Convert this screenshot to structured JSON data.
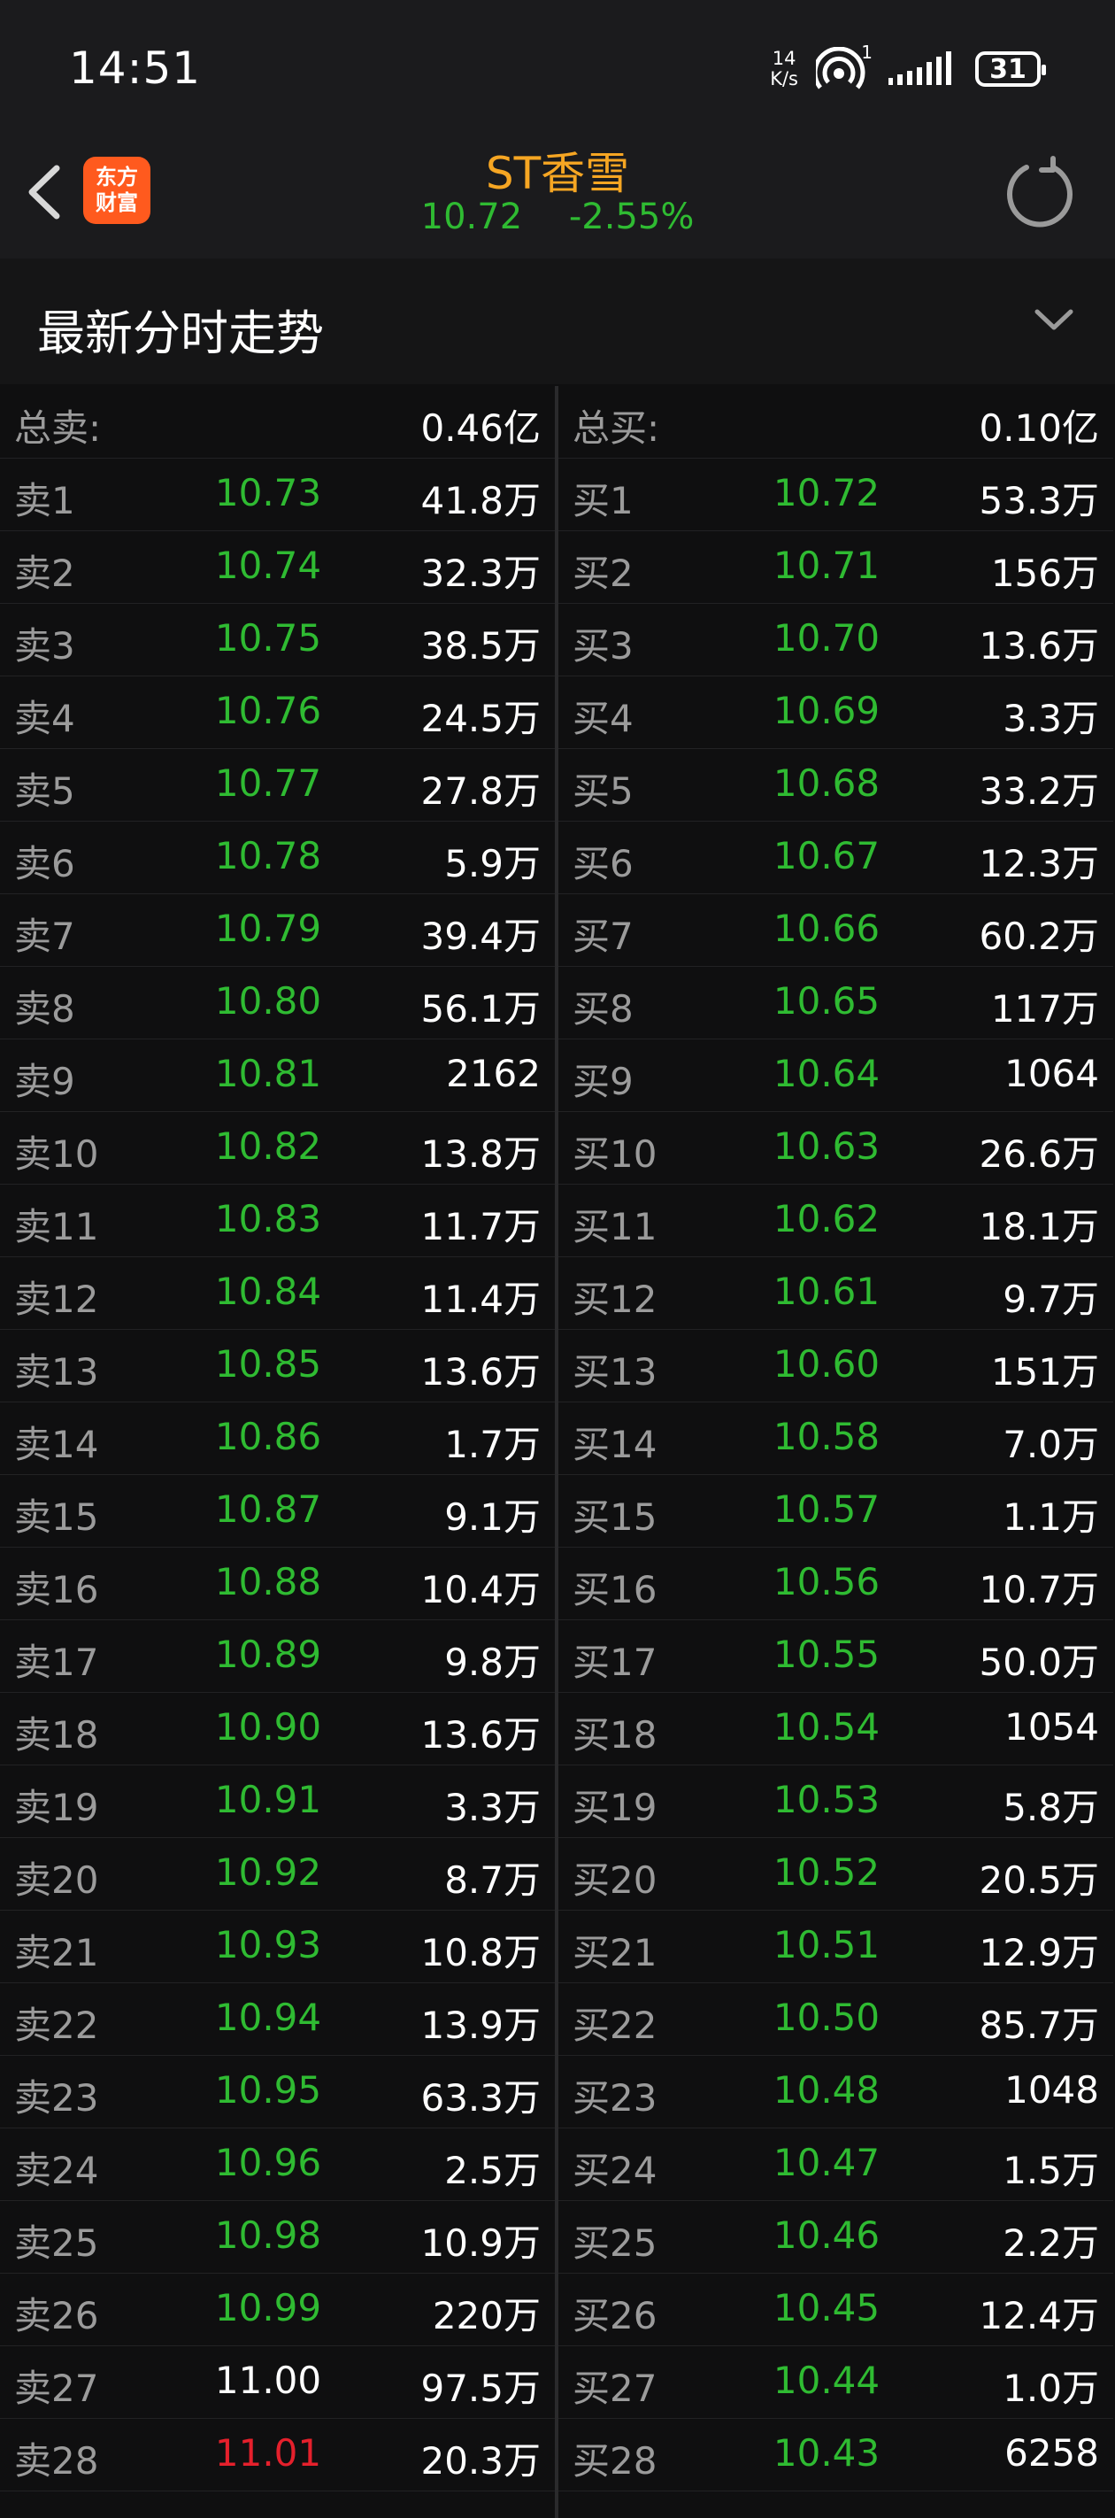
{
  "status_bar": {
    "time": "14:51",
    "net_speed_value": "14",
    "net_speed_unit": "K/s",
    "hotspot_badge": "1",
    "battery": "31"
  },
  "header": {
    "logo_line1": "东方",
    "logo_line2": "财富",
    "stock_name": "ST香雪",
    "price": "10.72",
    "change_pct": "-2.55%"
  },
  "section": {
    "title": "最新分时走势"
  },
  "colors": {
    "up_red": "#e5202c",
    "down_green": "#2fbb32",
    "flat_white": "#ffffff",
    "name_orange": "#f6a623",
    "logo_orange": "#ff5a1e"
  },
  "sell_side": {
    "total_label": "总卖:",
    "total_value": "0.46亿",
    "levels": [
      {
        "label": "卖1",
        "price": "10.73",
        "volume": "41.8万",
        "dir": "down"
      },
      {
        "label": "卖2",
        "price": "10.74",
        "volume": "32.3万",
        "dir": "down"
      },
      {
        "label": "卖3",
        "price": "10.75",
        "volume": "38.5万",
        "dir": "down"
      },
      {
        "label": "卖4",
        "price": "10.76",
        "volume": "24.5万",
        "dir": "down"
      },
      {
        "label": "卖5",
        "price": "10.77",
        "volume": "27.8万",
        "dir": "down"
      },
      {
        "label": "卖6",
        "price": "10.78",
        "volume": "5.9万",
        "dir": "down"
      },
      {
        "label": "卖7",
        "price": "10.79",
        "volume": "39.4万",
        "dir": "down"
      },
      {
        "label": "卖8",
        "price": "10.80",
        "volume": "56.1万",
        "dir": "down"
      },
      {
        "label": "卖9",
        "price": "10.81",
        "volume": "2162",
        "dir": "down"
      },
      {
        "label": "卖10",
        "price": "10.82",
        "volume": "13.8万",
        "dir": "down"
      },
      {
        "label": "卖11",
        "price": "10.83",
        "volume": "11.7万",
        "dir": "down"
      },
      {
        "label": "卖12",
        "price": "10.84",
        "volume": "11.4万",
        "dir": "down"
      },
      {
        "label": "卖13",
        "price": "10.85",
        "volume": "13.6万",
        "dir": "down"
      },
      {
        "label": "卖14",
        "price": "10.86",
        "volume": "1.7万",
        "dir": "down"
      },
      {
        "label": "卖15",
        "price": "10.87",
        "volume": "9.1万",
        "dir": "down"
      },
      {
        "label": "卖16",
        "price": "10.88",
        "volume": "10.4万",
        "dir": "down"
      },
      {
        "label": "卖17",
        "price": "10.89",
        "volume": "9.8万",
        "dir": "down"
      },
      {
        "label": "卖18",
        "price": "10.90",
        "volume": "13.6万",
        "dir": "down"
      },
      {
        "label": "卖19",
        "price": "10.91",
        "volume": "3.3万",
        "dir": "down"
      },
      {
        "label": "卖20",
        "price": "10.92",
        "volume": "8.7万",
        "dir": "down"
      },
      {
        "label": "卖21",
        "price": "10.93",
        "volume": "10.8万",
        "dir": "down"
      },
      {
        "label": "卖22",
        "price": "10.94",
        "volume": "13.9万",
        "dir": "down"
      },
      {
        "label": "卖23",
        "price": "10.95",
        "volume": "63.3万",
        "dir": "down"
      },
      {
        "label": "卖24",
        "price": "10.96",
        "volume": "2.5万",
        "dir": "down"
      },
      {
        "label": "卖25",
        "price": "10.98",
        "volume": "10.9万",
        "dir": "down"
      },
      {
        "label": "卖26",
        "price": "10.99",
        "volume": "220万",
        "dir": "down"
      },
      {
        "label": "卖27",
        "price": "11.00",
        "volume": "97.5万",
        "dir": "flat"
      },
      {
        "label": "卖28",
        "price": "11.01",
        "volume": "20.3万",
        "dir": "up"
      }
    ]
  },
  "buy_side": {
    "total_label": "总买:",
    "total_value": "0.10亿",
    "levels": [
      {
        "label": "买1",
        "price": "10.72",
        "volume": "53.3万",
        "dir": "down"
      },
      {
        "label": "买2",
        "price": "10.71",
        "volume": "156万",
        "dir": "down"
      },
      {
        "label": "买3",
        "price": "10.70",
        "volume": "13.6万",
        "dir": "down"
      },
      {
        "label": "买4",
        "price": "10.69",
        "volume": "3.3万",
        "dir": "down"
      },
      {
        "label": "买5",
        "price": "10.68",
        "volume": "33.2万",
        "dir": "down"
      },
      {
        "label": "买6",
        "price": "10.67",
        "volume": "12.3万",
        "dir": "down"
      },
      {
        "label": "买7",
        "price": "10.66",
        "volume": "60.2万",
        "dir": "down"
      },
      {
        "label": "买8",
        "price": "10.65",
        "volume": "117万",
        "dir": "down"
      },
      {
        "label": "买9",
        "price": "10.64",
        "volume": "1064",
        "dir": "down"
      },
      {
        "label": "买10",
        "price": "10.63",
        "volume": "26.6万",
        "dir": "down"
      },
      {
        "label": "买11",
        "price": "10.62",
        "volume": "18.1万",
        "dir": "down"
      },
      {
        "label": "买12",
        "price": "10.61",
        "volume": "9.7万",
        "dir": "down"
      },
      {
        "label": "买13",
        "price": "10.60",
        "volume": "151万",
        "dir": "down"
      },
      {
        "label": "买14",
        "price": "10.58",
        "volume": "7.0万",
        "dir": "down"
      },
      {
        "label": "买15",
        "price": "10.57",
        "volume": "1.1万",
        "dir": "down"
      },
      {
        "label": "买16",
        "price": "10.56",
        "volume": "10.7万",
        "dir": "down"
      },
      {
        "label": "买17",
        "price": "10.55",
        "volume": "50.0万",
        "dir": "down"
      },
      {
        "label": "买18",
        "price": "10.54",
        "volume": "1054",
        "dir": "down"
      },
      {
        "label": "买19",
        "price": "10.53",
        "volume": "5.8万",
        "dir": "down"
      },
      {
        "label": "买20",
        "price": "10.52",
        "volume": "20.5万",
        "dir": "down"
      },
      {
        "label": "买21",
        "price": "10.51",
        "volume": "12.9万",
        "dir": "down"
      },
      {
        "label": "买22",
        "price": "10.50",
        "volume": "85.7万",
        "dir": "down"
      },
      {
        "label": "买23",
        "price": "10.48",
        "volume": "1048",
        "dir": "down"
      },
      {
        "label": "买24",
        "price": "10.47",
        "volume": "1.5万",
        "dir": "down"
      },
      {
        "label": "买25",
        "price": "10.46",
        "volume": "2.2万",
        "dir": "down"
      },
      {
        "label": "买26",
        "price": "10.45",
        "volume": "12.4万",
        "dir": "down"
      },
      {
        "label": "买27",
        "price": "10.44",
        "volume": "1.0万",
        "dir": "down"
      },
      {
        "label": "买28",
        "price": "10.43",
        "volume": "6258",
        "dir": "down"
      }
    ]
  }
}
